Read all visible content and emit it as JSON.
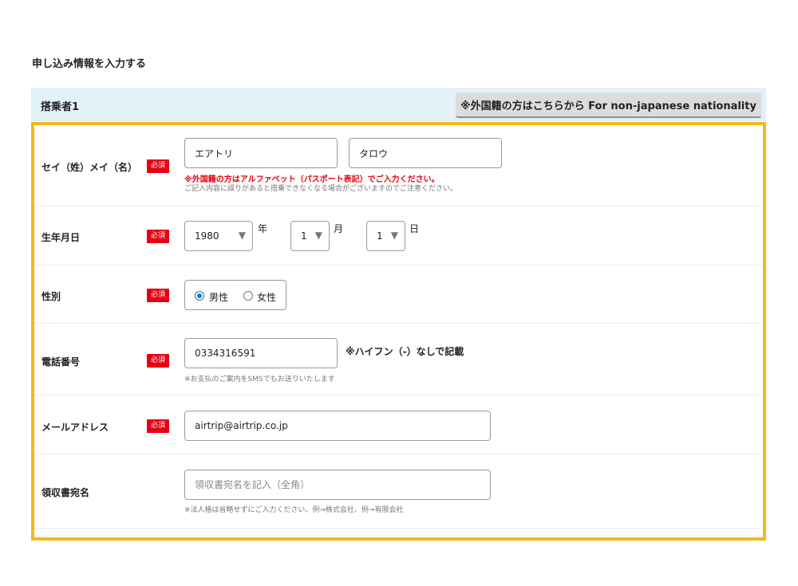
{
  "page": {
    "title": "申し込み情報を入力する"
  },
  "section": {
    "title": "搭乗者1",
    "foreign_button": "※外国籍の方はこちらから For non-japanese nationality"
  },
  "required_label": "必須",
  "name_row": {
    "label": "セイ（姓）メイ（名）",
    "last_name_value": "エアトリ",
    "first_name_value": "タロウ",
    "note_red": "※外国籍の方はアルファベット（パスポート表記）でご入力ください。",
    "note_gray": "ご記入内容に誤りがあると搭乗できなくなる場合がございますのでご注意ください。"
  },
  "birth_row": {
    "label": "生年月日",
    "year_value": "1980",
    "year_unit": "年",
    "month_value": "1",
    "month_unit": "月",
    "day_value": "1",
    "day_unit": "日"
  },
  "gender_row": {
    "label": "性別",
    "options": [
      {
        "label": "男性",
        "selected": true
      },
      {
        "label": "女性",
        "selected": false
      }
    ]
  },
  "phone_row": {
    "label": "電話番号",
    "value": "0334316591",
    "hint": "※ハイフン（-）なしで記載",
    "note": "※お支払のご案内をSMSでもお送りいたします"
  },
  "email_row": {
    "label": "メールアドレス",
    "value": "airtrip@airtrip.co.jp"
  },
  "receipt_row": {
    "label": "領収書宛名",
    "placeholder": "領収書宛名を記入（全角）",
    "note": "※法人格は省略せずにご入力ください。例→株式会社、例→有限会社"
  },
  "colors": {
    "frame": "#f3b81c",
    "header_bg": "#e3f1f8",
    "required": "#e60012",
    "radio_selected": "#1976d2"
  },
  "icons": {
    "select_arrow": "▼"
  }
}
